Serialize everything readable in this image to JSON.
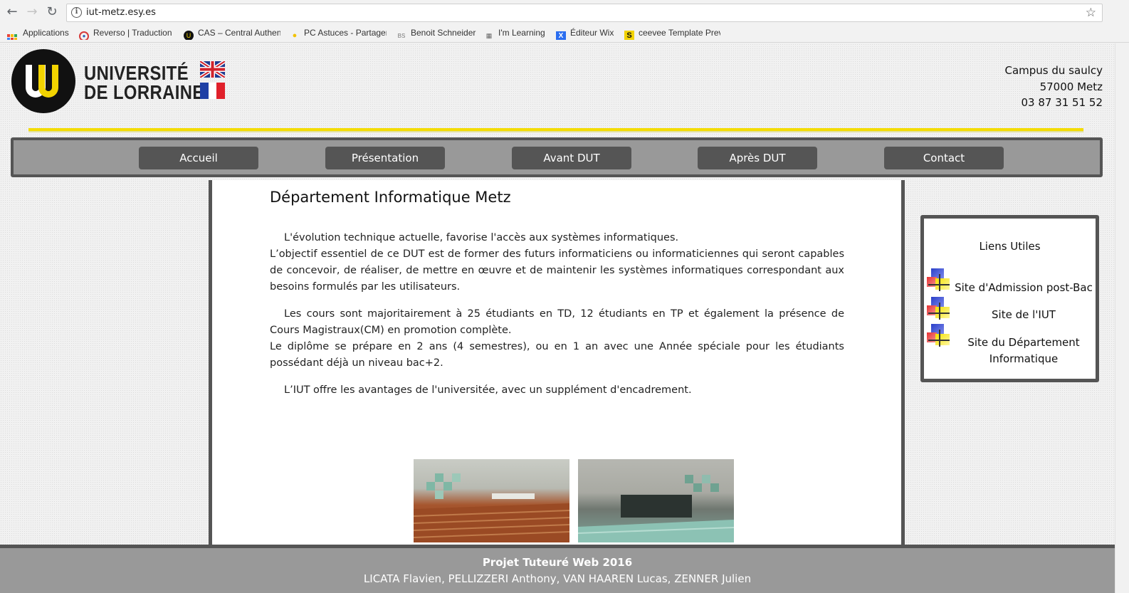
{
  "browser": {
    "url": "iut-metz.esy.es",
    "bookmarks": [
      {
        "label": "Applications",
        "icon": "apps-grid-icon"
      },
      {
        "label": "Reverso | Traduction",
        "icon": "reverso-icon"
      },
      {
        "label": "CAS – Central Authen",
        "icon": "lorraine-icon"
      },
      {
        "label": "PC Astuces - Partager",
        "icon": "bulb-icon"
      },
      {
        "label": "Benoit Schneider",
        "icon": "bs-icon"
      },
      {
        "label": "I'm Learning",
        "icon": "learning-icon"
      },
      {
        "label": "Éditeur Wix",
        "icon": "wix-icon"
      },
      {
        "label": "ceevee Template Prev",
        "icon": "s-icon"
      }
    ]
  },
  "header": {
    "logo_line1": "UNIVERSITÉ",
    "logo_line2": "DE LORRAINE",
    "address": [
      "Campus du saulcy",
      "57000 Metz",
      "03 87 31 51 52"
    ]
  },
  "nav": [
    "Accueil",
    "Présentation",
    "Avant DUT",
    "Après DUT",
    "Contact"
  ],
  "main": {
    "title": "Département Informatique Metz",
    "p1_line1": "L'évolution technique actuelle, favorise l'accès aux systèmes informatiques.",
    "p1_line2": "L’objectif essentiel de ce DUT est de former des futurs informaticiens ou informaticiennes qui seront capables de concevoir, de réaliser, de mettre en œuvre et de maintenir les systèmes informatiques correspondant aux besoins formulés par les utilisateurs.",
    "p2_line1": "Les cours sont majoritairement à 25 étudiants en TD, 12 étudiants en TP et également la présence de Cours Magistraux(CM) en promotion complète.",
    "p2_line2": "Le diplôme se prépare en 2 ans (4 semestres), ou en 1 an avec une Année spéciale pour les étudiants possédant déjà un niveau bac+2.",
    "p3": "L’IUT offre les avantages de l'universitée, avec un supplément d'encadrement."
  },
  "links": {
    "title": "Liens Utiles",
    "items": [
      "Site d'Admission post-Bac",
      "Site de l'IUT",
      "Site du Département Informatique"
    ]
  },
  "footer": {
    "title": "Projet Tuteuré Web 2016",
    "names": "LICATA Flavien, PELLIZZERI Anthony, VAN HAAREN Lucas, ZENNER Julien"
  },
  "colors": {
    "accent_yellow": "#f4dc00",
    "nav_dark": "#555555",
    "nav_bg": "#999999"
  }
}
